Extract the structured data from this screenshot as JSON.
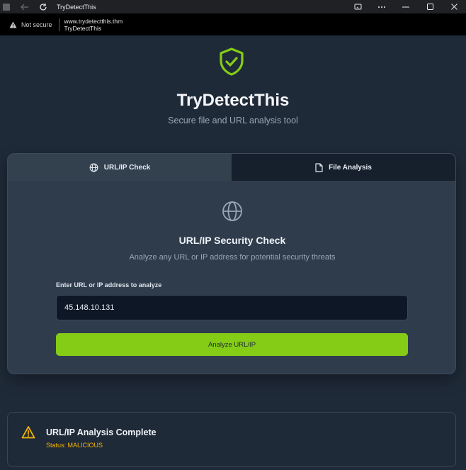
{
  "window": {
    "title": "TryDetectThis",
    "controls": [
      "cast-icon",
      "more-icon",
      "minimize-icon",
      "maximize-icon",
      "close-icon"
    ]
  },
  "address": {
    "security_label": "Not secure",
    "url": "www.trydetectthis.thm",
    "page_title": "TryDetectThis"
  },
  "header": {
    "title": "TryDetectThis",
    "subtitle": "Secure file and URL analysis tool"
  },
  "tabs": [
    {
      "label": "URL/IP Check",
      "icon": "globe-icon",
      "active": true
    },
    {
      "label": "File Analysis",
      "icon": "file-icon",
      "active": false
    }
  ],
  "check": {
    "title": "URL/IP Security Check",
    "subtitle": "Analyze any URL or IP address for potential security threats",
    "input_label": "Enter URL or IP address to analyze",
    "input_value": "45.148.10.131",
    "button_label": "Analyze URL/IP"
  },
  "result": {
    "title": "URL/IP Analysis Complete",
    "status": "Status: MALICIOUS",
    "icon": "warning-icon"
  },
  "colors": {
    "accent": "#84cc16",
    "background": "#1f2a38",
    "warning": "#f5b400"
  }
}
